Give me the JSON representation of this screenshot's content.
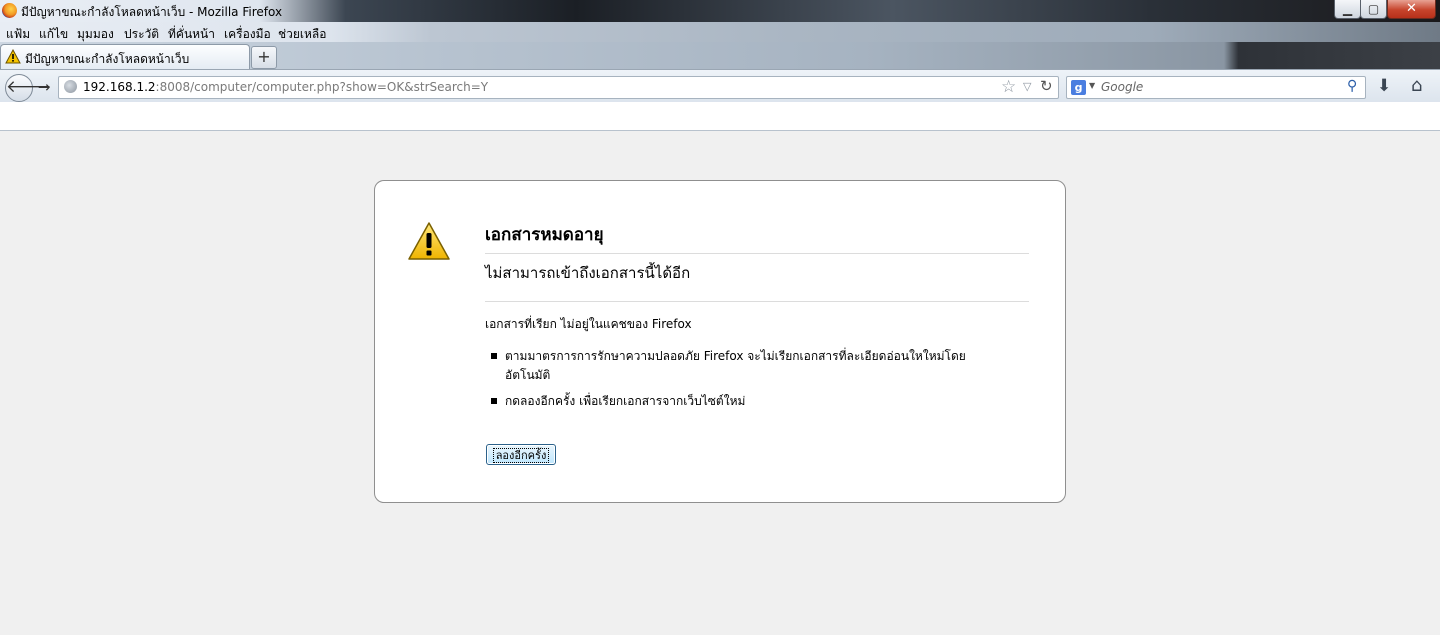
{
  "window": {
    "title": "มีปัญหาขณะกำลังโหลดหน้าเว็บ - Mozilla Firefox",
    "min_glyph": "▁",
    "max_glyph": "▢",
    "close_glyph": "✕"
  },
  "menu": {
    "items": [
      {
        "label": "แฟ้ม"
      },
      {
        "label": "แก้ไข"
      },
      {
        "label": "มุมมอง"
      },
      {
        "label": "ประวัติ"
      },
      {
        "label": "ที่คั่นหน้า"
      },
      {
        "label": "เครื่องมือ"
      },
      {
        "label": "ช่วยเหลือ"
      }
    ]
  },
  "tabs": {
    "active_title": "มีปัญหาขณะกำลังโหลดหน้าเว็บ",
    "new_tab_glyph": "+"
  },
  "nav": {
    "back_glyph": "🡐",
    "forward_glyph": "→",
    "url_host": "192.168.1.2",
    "url_rest": ":8008/computer/computer.php?show=OK&strSearch=Y",
    "star_glyph": "☆",
    "dropmarker_glyph": "▽",
    "reload_glyph": "↻",
    "search_engine_letter": "g",
    "search_engine_drop": "▼",
    "search_placeholder": "Google",
    "magnifier_glyph": "⚲",
    "download_glyph": "⬇",
    "home_glyph": "⌂"
  },
  "error": {
    "title": "เอกสารหมดอายุ",
    "subtitle": "ไม่สามารถเข้าถึงเอกสารนี้ได้อีก",
    "description": "เอกสารที่เรียก ไม่อยู่ในแคชของ Firefox",
    "bullets": [
      {
        "text": "ตามมาตรการการรักษาความปลอดภัย Firefox จะไม่เรียกเอกสารที่ละเอียดอ่อนใหใหม่โดยอัตโนมัติ"
      },
      {
        "text": "กดลองอีกครั้ง เพื่อเรียกเอกสารจากเว็บไซต์ใหม่"
      }
    ],
    "retry_label": "ลองอีกครั้ง"
  },
  "colors": {
    "warning_fill": "#f5c400",
    "page_background": "#f0f0f0"
  }
}
